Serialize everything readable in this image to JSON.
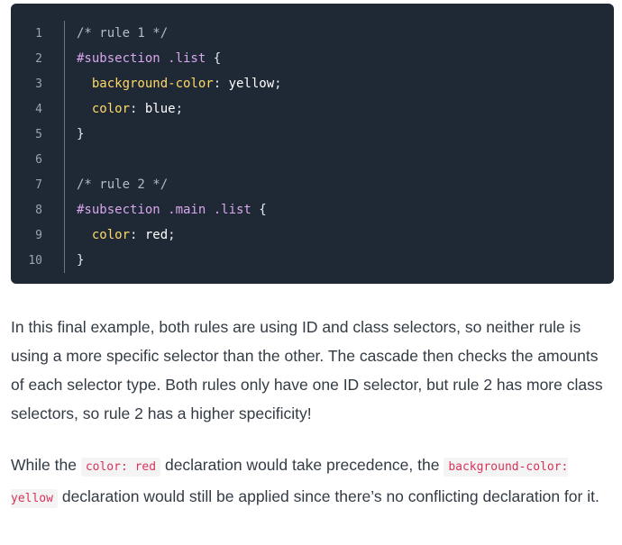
{
  "code_block": {
    "lines": [
      {
        "num": "1",
        "parts": [
          {
            "t": "/* rule 1 */",
            "c": "comment"
          }
        ]
      },
      {
        "num": "2",
        "parts": [
          {
            "t": "#subsection .list",
            "c": "selector"
          },
          {
            "t": " {",
            "c": "punct"
          }
        ]
      },
      {
        "num": "3",
        "parts": [
          {
            "t": "  ",
            "c": "punct"
          },
          {
            "t": "background-color",
            "c": "property"
          },
          {
            "t": ": ",
            "c": "punct"
          },
          {
            "t": "yellow",
            "c": "value"
          },
          {
            "t": ";",
            "c": "punct"
          }
        ]
      },
      {
        "num": "4",
        "parts": [
          {
            "t": "  ",
            "c": "punct"
          },
          {
            "t": "color",
            "c": "property"
          },
          {
            "t": ": ",
            "c": "punct"
          },
          {
            "t": "blue",
            "c": "value"
          },
          {
            "t": ";",
            "c": "punct"
          }
        ]
      },
      {
        "num": "5",
        "parts": [
          {
            "t": "}",
            "c": "punct"
          }
        ]
      },
      {
        "num": "6",
        "parts": []
      },
      {
        "num": "7",
        "parts": [
          {
            "t": "/* rule 2 */",
            "c": "comment"
          }
        ]
      },
      {
        "num": "8",
        "parts": [
          {
            "t": "#subsection .main .list",
            "c": "selector"
          },
          {
            "t": " {",
            "c": "punct"
          }
        ]
      },
      {
        "num": "9",
        "parts": [
          {
            "t": "  ",
            "c": "punct"
          },
          {
            "t": "color",
            "c": "property"
          },
          {
            "t": ": ",
            "c": "punct"
          },
          {
            "t": "red",
            "c": "value"
          },
          {
            "t": ";",
            "c": "punct"
          }
        ]
      },
      {
        "num": "10",
        "parts": [
          {
            "t": "}",
            "c": "punct"
          }
        ]
      }
    ]
  },
  "paragraph_1": {
    "text": "In this final example, both rules are using ID and class selectors, so neither rule is using a more specific selector than the other. The cascade then checks the amounts of each selector type. Both rules only have one ID selector, but rule 2 has more class selectors, so rule 2 has a higher specificity!"
  },
  "paragraph_2": {
    "before": "While the ",
    "code_1": "color: red",
    "middle": " declaration would take precedence, the ",
    "code_2": "background-color: yellow",
    "after": " declaration would still be applied since there’s no conflicting declaration for it."
  },
  "colors": {
    "code_background": "#1f2936",
    "comment": "#b2bcc8",
    "selector": "#d8a6ec",
    "property": "#ffd866",
    "value": "#ffffff",
    "inline_code_text": "#d7335a",
    "body_text": "#333b45"
  }
}
